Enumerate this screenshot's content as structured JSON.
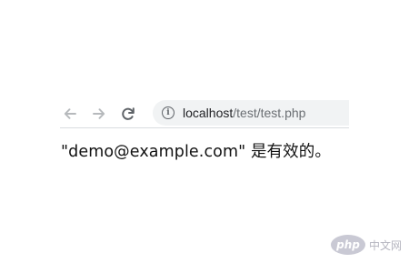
{
  "browser": {
    "toolbar": {
      "back_icon": "arrow-left-icon",
      "forward_icon": "arrow-right-icon",
      "reload_icon": "reload-icon"
    },
    "address_bar": {
      "icon": "info-icon",
      "host": "localhost",
      "path": "/test/test.php"
    }
  },
  "page": {
    "message": "\"demo@example.com\" 是有效的。"
  },
  "watermark": {
    "logo_text": "php",
    "text": "中文网"
  },
  "colors": {
    "toolbar_icon_disabled": "#b6b9bc",
    "toolbar_icon_active": "#5f6368",
    "omnibox_bg": "#f1f3f4"
  }
}
